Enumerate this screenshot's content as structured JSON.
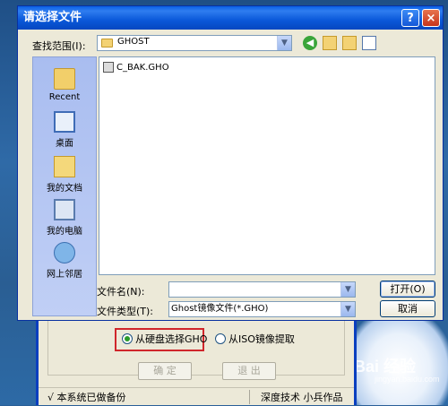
{
  "dialog": {
    "title": "请选择文件",
    "help_glyph": "?",
    "close_glyph": "×",
    "lookin_label": "查找范围(I):",
    "lookin_value": "GHOST",
    "places": [
      {
        "label": "Recent"
      },
      {
        "label": "桌面"
      },
      {
        "label": "我的文档"
      },
      {
        "label": "我的电脑"
      },
      {
        "label": "网上邻居"
      }
    ],
    "files": [
      {
        "name": "C_BAK.GHO"
      }
    ],
    "filename_label": "文件名(N):",
    "filename_value": "",
    "filetype_label": "文件类型(T):",
    "filetype_value": "Ghost镜像文件(*.GHO)",
    "open_button": "打开(O)",
    "cancel_button": "取消"
  },
  "background_app": {
    "radio_disk": "从硬盘选择GHO",
    "radio_iso": "从ISO镜像提取",
    "ok_button": "确 定",
    "exit_button": "退 出",
    "status_left": "√ 本系统已做备份",
    "status_right": "深度技术 小兵作品"
  },
  "watermark": {
    "brand": "Bai 经验",
    "sub": "jingyan.baidu.com"
  },
  "colors": {
    "titlebar": "#0a58d9",
    "highlight_box": "#d0262b"
  }
}
